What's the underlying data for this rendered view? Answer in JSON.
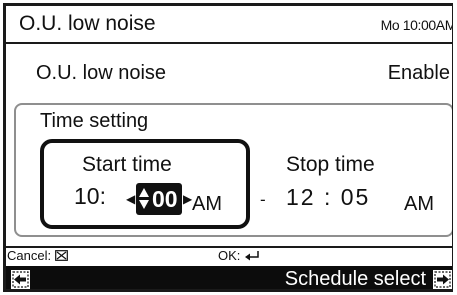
{
  "header": {
    "title": "O.U. low noise",
    "clock": "Mo 10:00AM"
  },
  "setting": {
    "label": "O.U. low noise",
    "value": "Enable"
  },
  "time_setting": {
    "title": "Time setting",
    "start": {
      "label": "Start time",
      "hour": "10:",
      "minute": "00",
      "ampm": "AM"
    },
    "separator": "-",
    "stop": {
      "label": "Stop time",
      "time": "12 : 05",
      "ampm": "AM"
    }
  },
  "hints": {
    "cancel_label": "Cancel:",
    "ok_label": "OK:"
  },
  "footer": {
    "label": "Schedule select"
  },
  "icons": {
    "cancel": "cancel-button-icon",
    "ok": "enter-icon",
    "back": "back-icon",
    "forward": "forward-icon",
    "left_arrow": "left-arrow-icon",
    "right_arrow": "right-arrow-icon",
    "updown": "up-down-arrow-icon"
  }
}
